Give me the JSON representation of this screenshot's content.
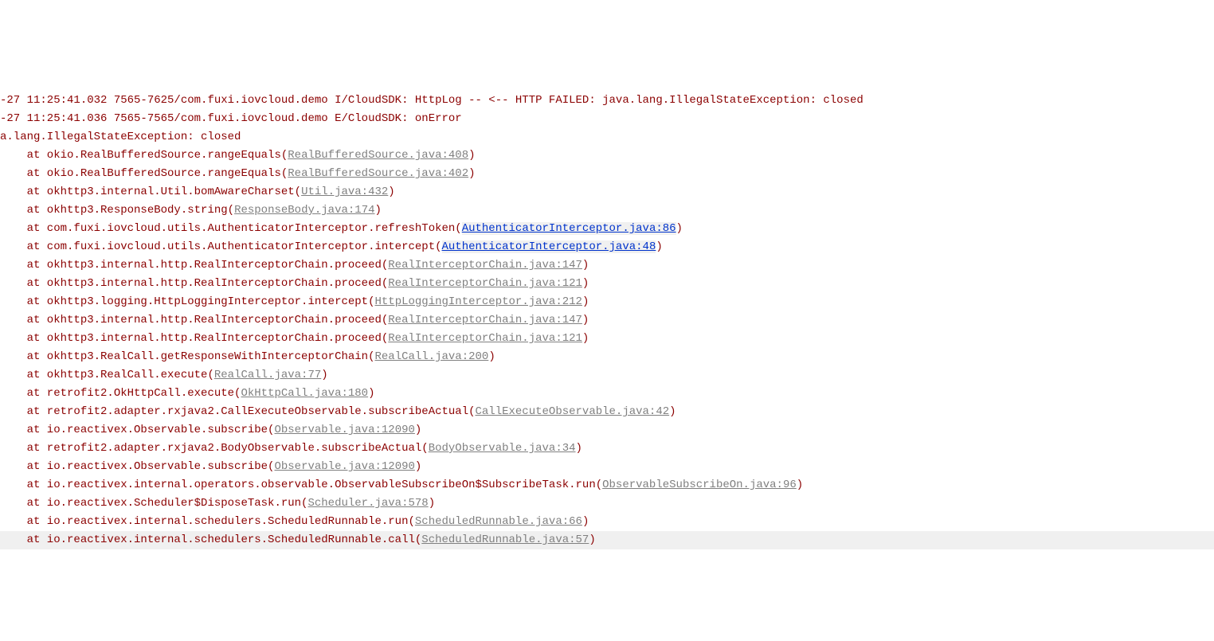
{
  "header_lines": [
    {
      "left": "-27 11:25:41.032 7565-7625/com.fuxi.iovcloud.demo I/CloudSDK: HttpLog -- <-- HTTP FAILED: java.lang.IllegalStateException: closed"
    },
    {
      "left": "-27 11:25:41.036 7565-7565/com.fuxi.iovcloud.demo E/CloudSDK: onError"
    },
    {
      "left": "a.lang.IllegalStateException: closed"
    }
  ],
  "stack": [
    {
      "pre": "    at okio.RealBufferedSource.rangeEquals(",
      "link": "RealBufferedSource.java:408",
      "post": ")",
      "kind": "grey"
    },
    {
      "pre": "    at okio.RealBufferedSource.rangeEquals(",
      "link": "RealBufferedSource.java:402",
      "post": ")",
      "kind": "grey"
    },
    {
      "pre": "    at okhttp3.internal.Util.bomAwareCharset(",
      "link": "Util.java:432",
      "post": ")",
      "kind": "grey"
    },
    {
      "pre": "    at okhttp3.ResponseBody.string(",
      "link": "ResponseBody.java:174",
      "post": ")",
      "kind": "grey"
    },
    {
      "pre": "    at com.fuxi.iovcloud.utils.AuthenticatorInterceptor.refreshToken(",
      "link": "AuthenticatorInterceptor.java:86",
      "post": ")",
      "kind": "blue"
    },
    {
      "pre": "    at com.fuxi.iovcloud.utils.AuthenticatorInterceptor.intercept(",
      "link": "AuthenticatorInterceptor.java:48",
      "post": ")",
      "kind": "blue"
    },
    {
      "pre": "    at okhttp3.internal.http.RealInterceptorChain.proceed(",
      "link": "RealInterceptorChain.java:147",
      "post": ")",
      "kind": "grey"
    },
    {
      "pre": "    at okhttp3.internal.http.RealInterceptorChain.proceed(",
      "link": "RealInterceptorChain.java:121",
      "post": ")",
      "kind": "grey"
    },
    {
      "pre": "    at okhttp3.logging.HttpLoggingInterceptor.intercept(",
      "link": "HttpLoggingInterceptor.java:212",
      "post": ")",
      "kind": "grey"
    },
    {
      "pre": "    at okhttp3.internal.http.RealInterceptorChain.proceed(",
      "link": "RealInterceptorChain.java:147",
      "post": ")",
      "kind": "grey"
    },
    {
      "pre": "    at okhttp3.internal.http.RealInterceptorChain.proceed(",
      "link": "RealInterceptorChain.java:121",
      "post": ")",
      "kind": "grey"
    },
    {
      "pre": "    at okhttp3.RealCall.getResponseWithInterceptorChain(",
      "link": "RealCall.java:200",
      "post": ")",
      "kind": "grey"
    },
    {
      "pre": "    at okhttp3.RealCall.execute(",
      "link": "RealCall.java:77",
      "post": ")",
      "kind": "grey"
    },
    {
      "pre": "    at retrofit2.OkHttpCall.execute(",
      "link": "OkHttpCall.java:180",
      "post": ")",
      "kind": "grey"
    },
    {
      "pre": "    at retrofit2.adapter.rxjava2.CallExecuteObservable.subscribeActual(",
      "link": "CallExecuteObservable.java:42",
      "post": ")",
      "kind": "grey"
    },
    {
      "pre": "    at io.reactivex.Observable.subscribe(",
      "link": "Observable.java:12090",
      "post": ")",
      "kind": "grey"
    },
    {
      "pre": "    at retrofit2.adapter.rxjava2.BodyObservable.subscribeActual(",
      "link": "BodyObservable.java:34",
      "post": ")",
      "kind": "grey"
    },
    {
      "pre": "    at io.reactivex.Observable.subscribe(",
      "link": "Observable.java:12090",
      "post": ")",
      "kind": "grey"
    },
    {
      "pre": "    at io.reactivex.internal.operators.observable.ObservableSubscribeOn$SubscribeTask.run(",
      "link": "ObservableSubscribeOn.java:96",
      "post": ")",
      "kind": "grey"
    },
    {
      "pre": "    at io.reactivex.Scheduler$DisposeTask.run(",
      "link": "Scheduler.java:578",
      "post": ")",
      "kind": "grey"
    },
    {
      "pre": "    at io.reactivex.internal.schedulers.ScheduledRunnable.run(",
      "link": "ScheduledRunnable.java:66",
      "post": ")",
      "kind": "grey"
    },
    {
      "pre": "    at io.reactivex.internal.schedulers.ScheduledRunnable.call(",
      "link": "ScheduledRunnable.java:57",
      "post": ")",
      "kind": "grey",
      "hl": true
    }
  ]
}
